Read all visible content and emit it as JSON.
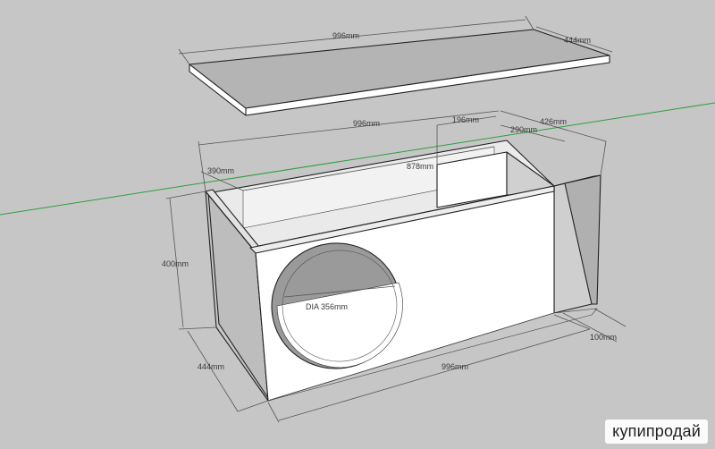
{
  "dimensions": {
    "lid_length": "996mm",
    "lid_width": "444mm",
    "top_length": "996mm",
    "top_196": "196mm",
    "top_426": "426mm",
    "top_290": "290mm",
    "inner_390": "390mm",
    "inner_878": "878mm",
    "height": "400mm",
    "port_dia": "DIA 356mm",
    "depth": "444mm",
    "bottom_length": "996mm",
    "port_100": "100mm"
  },
  "watermark": "купипродай",
  "colors": {
    "background": "#c6c6c6",
    "panel_face": "#ffffff",
    "panel_side": "#b9b9b9",
    "panel_inner": "#e6e6e6",
    "edge": "#222222",
    "axis_green": "#2e9e3e"
  }
}
